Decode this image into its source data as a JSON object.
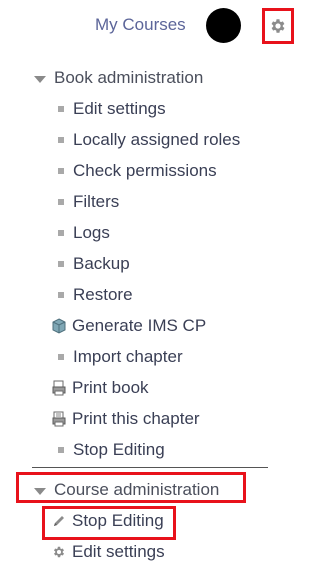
{
  "header": {
    "my_courses": "My Courses",
    "avatar_color": "#000000",
    "settings_icon": "gear-icon"
  },
  "book_admin": {
    "title": "Book administration",
    "items": [
      {
        "label": "Edit settings",
        "icon": "square-bullet"
      },
      {
        "label": "Locally assigned roles",
        "icon": "square-bullet"
      },
      {
        "label": "Check permissions",
        "icon": "square-bullet"
      },
      {
        "label": "Filters",
        "icon": "square-bullet"
      },
      {
        "label": "Logs",
        "icon": "square-bullet"
      },
      {
        "label": "Backup",
        "icon": "square-bullet"
      },
      {
        "label": "Restore",
        "icon": "square-bullet"
      },
      {
        "label": "Generate IMS CP",
        "icon": "package-icon"
      },
      {
        "label": "Import chapter",
        "icon": "square-bullet"
      },
      {
        "label": "Print book",
        "icon": "print-book-icon"
      },
      {
        "label": "Print this chapter",
        "icon": "print-chapter-icon"
      },
      {
        "label": "Stop Editing",
        "icon": "square-bullet"
      }
    ]
  },
  "course_admin": {
    "title": "Course administration",
    "items": [
      {
        "label": "Stop Editing",
        "icon": "pencil-icon"
      },
      {
        "label": "Edit settings",
        "icon": "gear-icon"
      }
    ]
  },
  "colors": {
    "highlight": "#e8121b",
    "link": "#5c6599",
    "text": "#3a3f55"
  }
}
